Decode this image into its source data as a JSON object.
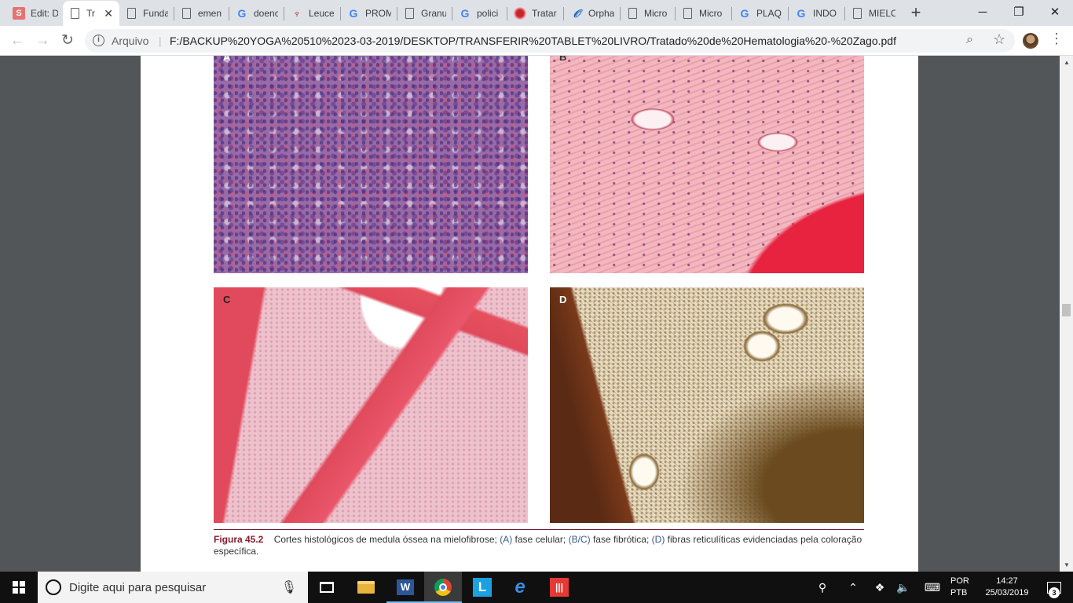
{
  "tabs": [
    {
      "title": "Edit: D",
      "icon": "s-icon",
      "active": false
    },
    {
      "title": "Tr",
      "icon": "document-icon",
      "active": true
    },
    {
      "title": "Funda",
      "icon": "document-icon",
      "active": false
    },
    {
      "title": "emen",
      "icon": "document-icon",
      "active": false
    },
    {
      "title": "doenc",
      "icon": "google-icon",
      "active": false
    },
    {
      "title": "Leuce",
      "icon": "leuce-icon",
      "active": false
    },
    {
      "title": "PROM",
      "icon": "google-icon",
      "active": false
    },
    {
      "title": "Granu",
      "icon": "document-icon",
      "active": false
    },
    {
      "title": "polici",
      "icon": "google-icon",
      "active": false
    },
    {
      "title": "Tratar",
      "icon": "red-cell-icon",
      "active": false
    },
    {
      "title": "Orpha",
      "icon": "orphanet-icon",
      "active": false
    },
    {
      "title": "Micro",
      "icon": "document-icon",
      "active": false
    },
    {
      "title": "Micro",
      "icon": "document-icon",
      "active": false
    },
    {
      "title": "PLAQ",
      "icon": "google-icon",
      "active": false
    },
    {
      "title": "INDO",
      "icon": "google-icon",
      "active": false
    },
    {
      "title": "MIELO",
      "icon": "document-icon",
      "active": false
    }
  ],
  "toolbar": {
    "scheme": "Arquivo",
    "url": "F:/BACKUP%20YOGA%20510%2023-03-2019/DESKTOP/TRANSFERIR%20TABLET%20LIVRO/Tratado%20de%20Hematologia%20-%20Zago.pdf"
  },
  "figure": {
    "panels": [
      {
        "letter": "A",
        "description_icon": "histology-cellular-phase"
      },
      {
        "letter": "B",
        "description_icon": "histology-fibrotic-phase"
      },
      {
        "letter": "C",
        "description_icon": "histology-fibrotic-phase-low-mag"
      },
      {
        "letter": "D",
        "description_icon": "reticulin-fibers-stain"
      }
    ],
    "caption_label": "Figura 45.2",
    "caption_text_1": "Cortes histológicos de medula óssea na mielofibrose;",
    "ref_a": "(A)",
    "caption_text_2": "fase celular;",
    "ref_bc": "(B/C)",
    "caption_text_3": "fase fibrótica;",
    "ref_d": "(D)",
    "caption_text_4": "fibras reticulíticas evidenciadas pela coloração específica."
  },
  "taskbar": {
    "search_placeholder": "Digite aqui para pesquisar",
    "lang_1": "POR",
    "lang_2": "PTB",
    "time": "14:27",
    "date": "25/03/2019",
    "notification_count": "3"
  },
  "colors": {
    "caption_label": "#8b1a2c",
    "caption_ref": "#3a5a8a",
    "viewer_bg": "#525659"
  }
}
